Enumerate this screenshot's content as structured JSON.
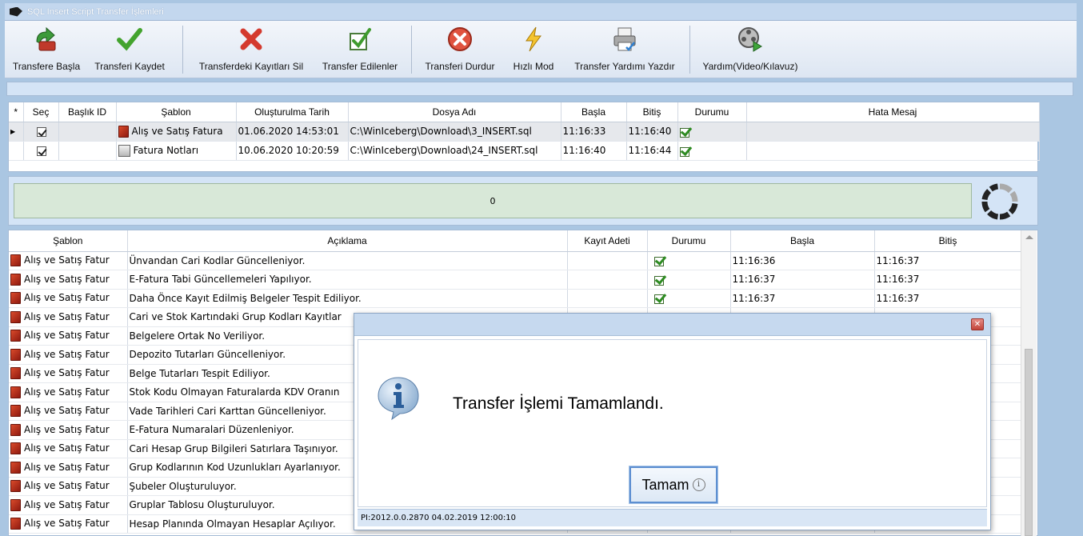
{
  "window": {
    "title": "SQL Insert Script Transfer İşlemleri"
  },
  "toolbar": {
    "buttons": [
      {
        "label": "Transfere Başla"
      },
      {
        "label": "Transferi Kaydet"
      },
      {
        "label": "Transferdeki Kayıtları Sil"
      },
      {
        "label": "Transfer Edilenler"
      },
      {
        "label": "Transferi Durdur"
      },
      {
        "label": "Hızlı Mod"
      },
      {
        "label": "Transfer Yardımı Yazdır"
      },
      {
        "label": "Yardım(Video/Kılavuz)"
      }
    ]
  },
  "grid1": {
    "headers": [
      "*",
      "Seç",
      "Başlık ID",
      "Şablon",
      "Oluşturulma Tarih",
      "Dosya Adı",
      "Başla",
      "Bitiş",
      "Durumu",
      "Hata Mesaj"
    ],
    "rows": [
      {
        "sablon": "Alış ve Satış Fatura",
        "tarih": "01.06.2020 14:53:01",
        "dosya": "C:\\WinIceberg\\Download\\3_INSERT.sql",
        "basla": "11:16:33",
        "bitis": "11:16:40"
      },
      {
        "sablon": "Fatura Notları",
        "tarih": "10.06.2020 10:20:59",
        "dosya": "C:\\WinIceberg\\Download\\24_INSERT.sql",
        "basla": "11:16:40",
        "bitis": "11:16:44"
      }
    ]
  },
  "progress": {
    "text": "0"
  },
  "grid2": {
    "headers": [
      "Şablon",
      "Açıklama",
      "Kayıt Adeti",
      "Durumu",
      "Başla",
      "Bitiş"
    ],
    "rows": [
      {
        "sablon": "Alış ve Satış Fatur",
        "aciklama": "Ünvandan Cari Kodlar Güncelleniyor.",
        "basla": "11:16:36",
        "bitis": "11:16:37"
      },
      {
        "sablon": "Alış ve Satış Fatur",
        "aciklama": "E-Fatura Tabi Güncellemeleri Yapılıyor.",
        "basla": "11:16:37",
        "bitis": "11:16:37"
      },
      {
        "sablon": "Alış ve Satış Fatur",
        "aciklama": "Daha Önce Kayıt Edilmiş Belgeler Tespit Ediliyor.",
        "basla": "11:16:37",
        "bitis": "11:16:37"
      },
      {
        "sablon": "Alış ve Satış Fatur",
        "aciklama": "Cari ve Stok Kartındaki Grup Kodları Kayıtlar",
        "basla": "",
        "bitis": ""
      },
      {
        "sablon": "Alış ve Satış Fatur",
        "aciklama": "Belgelere Ortak No Veriliyor.",
        "basla": "",
        "bitis": ""
      },
      {
        "sablon": "Alış ve Satış Fatur",
        "aciklama": "Depozito Tutarları Güncelleniyor.",
        "basla": "",
        "bitis": ""
      },
      {
        "sablon": "Alış ve Satış Fatur",
        "aciklama": "Belge Tutarları Tespit Ediliyor.",
        "basla": "",
        "bitis": ""
      },
      {
        "sablon": "Alış ve Satış Fatur",
        "aciklama": "Stok Kodu Olmayan Faturalarda KDV Oranın",
        "basla": "",
        "bitis": ""
      },
      {
        "sablon": "Alış ve Satış Fatur",
        "aciklama": "Vade Tarihleri Cari Karttan Güncelleniyor.",
        "basla": "",
        "bitis": ""
      },
      {
        "sablon": "Alış ve Satış Fatur",
        "aciklama": "E-Fatura Numaralari Düzenleniyor.",
        "basla": "",
        "bitis": ""
      },
      {
        "sablon": "Alış ve Satış Fatur",
        "aciklama": "Cari Hesap Grup Bilgileri Satırlara Taşınıyor.",
        "basla": "",
        "bitis": ""
      },
      {
        "sablon": "Alış ve Satış Fatur",
        "aciklama": "Grup Kodlarının Kod Uzunlukları Ayarlanıyor.",
        "basla": "",
        "bitis": ""
      },
      {
        "sablon": "Alış ve Satış Fatur",
        "aciklama": "Şubeler Oluşturuluyor.",
        "basla": "",
        "bitis": ""
      },
      {
        "sablon": "Alış ve Satış Fatur",
        "aciklama": "Gruplar Tablosu Oluşturuluyor.",
        "basla": "",
        "bitis": ""
      },
      {
        "sablon": "Alış ve Satış Fatur",
        "aciklama": "Hesap Planında Olmayan Hesaplar Açılıyor.",
        "basla": "",
        "bitis": ""
      }
    ]
  },
  "dialog": {
    "message": "Transfer İşlemi Tamamlandı.",
    "ok_label": "Tamam",
    "status": "PI:2012.0.0.2870 04.02.2019 12:00:10"
  }
}
